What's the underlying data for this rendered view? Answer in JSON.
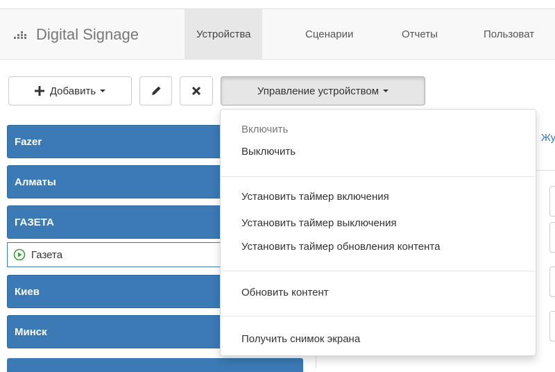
{
  "navbar": {
    "brand": "Digital Signage",
    "items": [
      {
        "label": "Устройства",
        "active": true
      },
      {
        "label": "Сценарии"
      },
      {
        "label": "Отчеты"
      },
      {
        "label": "Пользоват"
      }
    ]
  },
  "toolbar": {
    "add_label": "Добавить",
    "manage_label": "Управление устройством"
  },
  "groups": [
    {
      "label": "Fazer"
    },
    {
      "label": "Алматы"
    },
    {
      "label": "ГАЗЕТА"
    },
    {
      "label": "Киев"
    },
    {
      "label": "Минск"
    }
  ],
  "device": {
    "label": "Газета"
  },
  "right_peek": {
    "link": "Жу"
  },
  "dropdown": {
    "items": [
      {
        "label": "Включить",
        "disabled": true
      },
      {
        "label": "Выключить"
      },
      {
        "label": "Установить таймер включения"
      },
      {
        "label": "Установить таймер выключения"
      },
      {
        "label": "Установить таймер обновления контента"
      },
      {
        "label": "Обновить контент"
      },
      {
        "label": "Получить снимок экрана"
      }
    ]
  },
  "colors": {
    "group_bg": "#3b7ab5",
    "link": "#337ab7",
    "play_icon": "#3c9a3c"
  }
}
